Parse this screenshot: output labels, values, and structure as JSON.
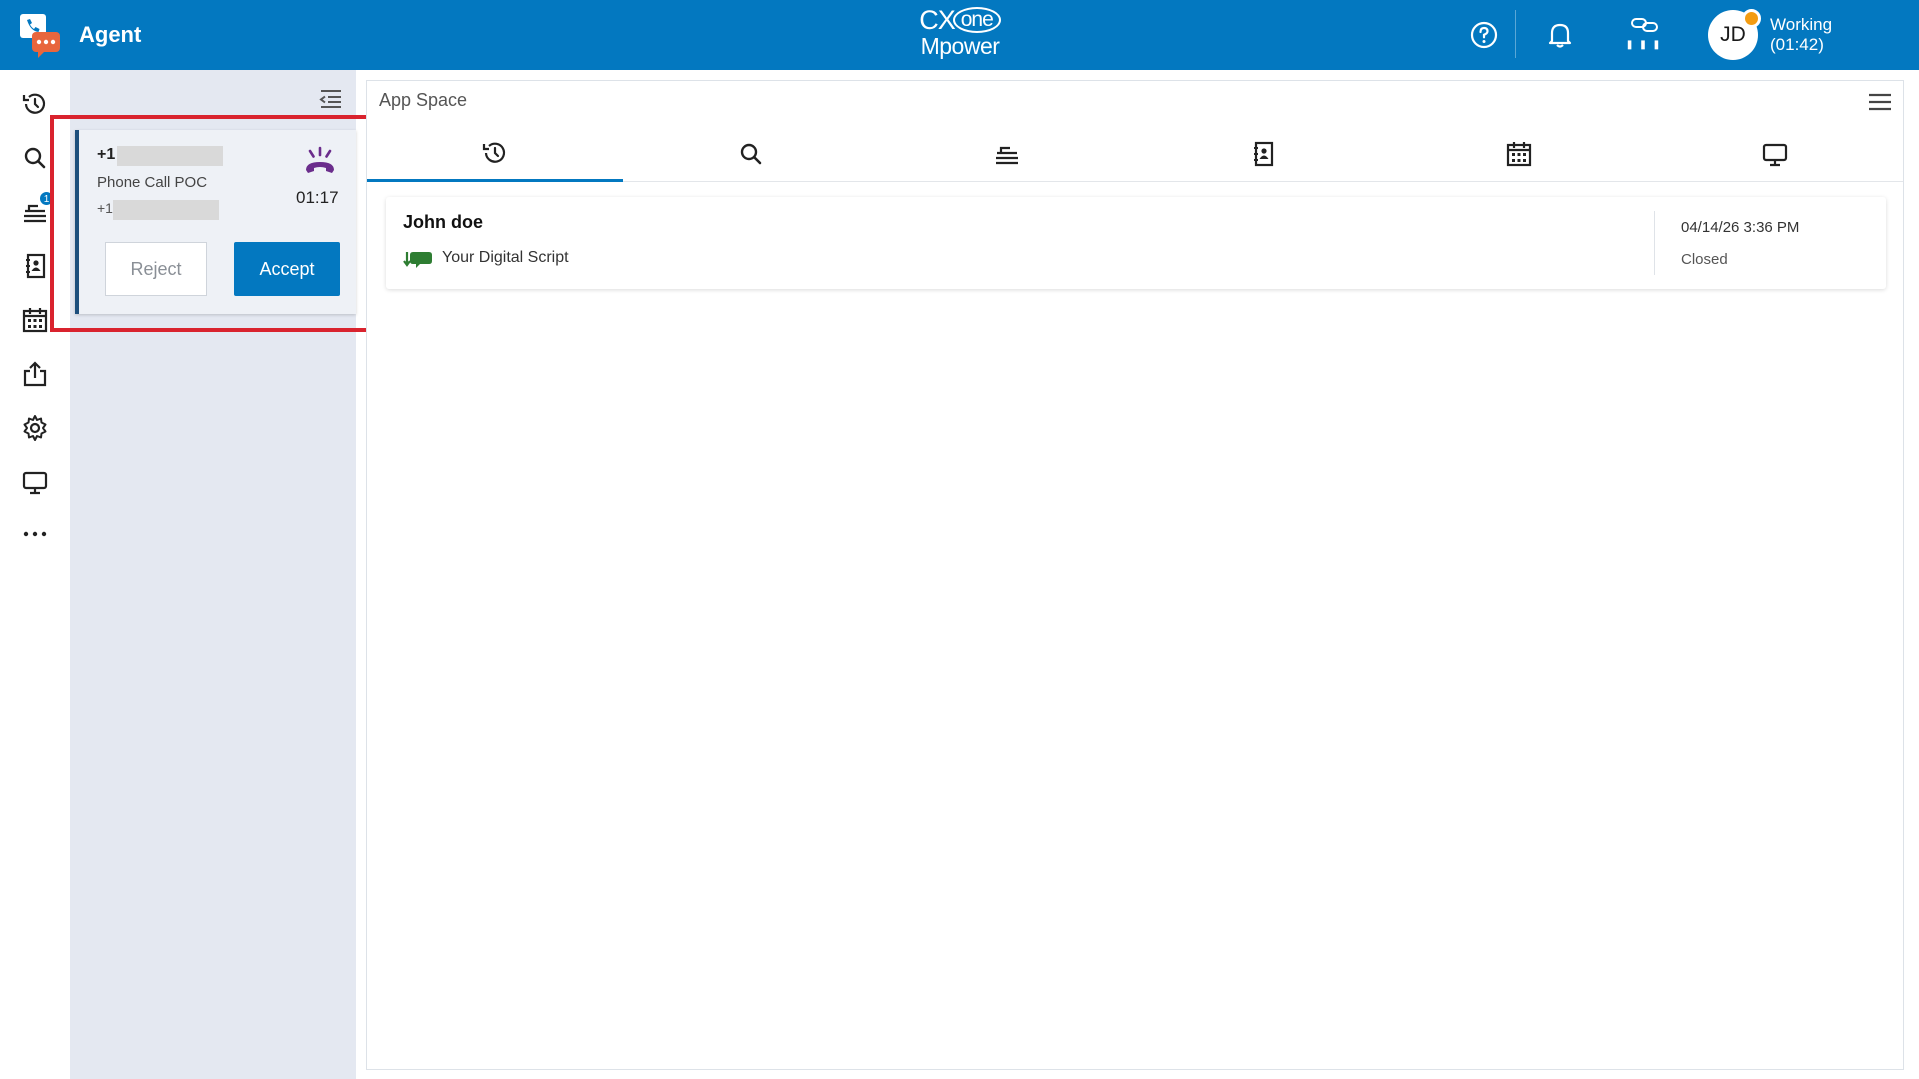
{
  "header": {
    "app_title": "Agent",
    "brand_top": "CX",
    "brand_one": "one",
    "brand_bottom": "Mpower",
    "status_label": "Working",
    "status_timer": "(01:42)",
    "avatar_initials": "JD",
    "accent_color": "#0378c0",
    "status_color": "#f39c12",
    "icons": [
      "help-icon",
      "bell-icon",
      "link-icon",
      "signal-bars-icon"
    ]
  },
  "rail": {
    "items": [
      {
        "name": "history-icon"
      },
      {
        "name": "search-icon"
      },
      {
        "name": "queue-icon",
        "badge": "1"
      },
      {
        "name": "contacts-book-icon"
      },
      {
        "name": "calendar-icon"
      },
      {
        "name": "share-icon"
      },
      {
        "name": "gear-icon"
      },
      {
        "name": "monitor-icon"
      },
      {
        "name": "more-icon"
      }
    ]
  },
  "call": {
    "number_prefix": "+1",
    "skill": "Phone Call POC",
    "secondary_prefix": "+1",
    "timer": "01:17",
    "reject_label": "Reject",
    "accept_label": "Accept",
    "highlight_color": "#d9232e"
  },
  "appspace": {
    "title": "App Space",
    "tabs": [
      {
        "name": "history-icon",
        "active": true
      },
      {
        "name": "search-icon"
      },
      {
        "name": "queue-icon"
      },
      {
        "name": "contacts-book-icon"
      },
      {
        "name": "calendar-icon"
      },
      {
        "name": "monitor-icon"
      }
    ],
    "interactions": [
      {
        "name": "John doe",
        "skill": "Your Digital Script",
        "date": "04/14/26 3:36 PM",
        "status": "Closed",
        "channel_icon": "inbound-chat-icon"
      }
    ]
  }
}
